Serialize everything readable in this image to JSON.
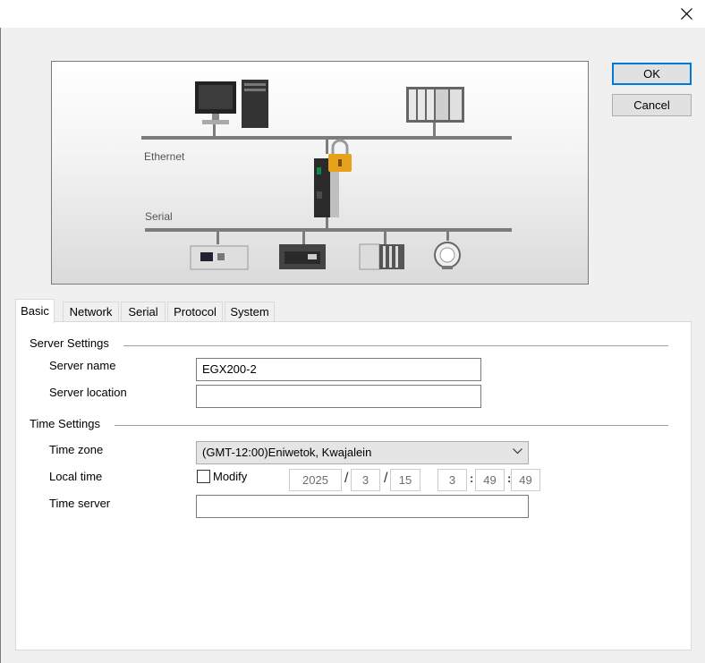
{
  "dialog": {
    "close_icon": "close-icon"
  },
  "diagram": {
    "ethernet_label": "Ethernet",
    "serial_label": "Serial"
  },
  "buttons": {
    "ok": "OK",
    "cancel": "Cancel"
  },
  "tabs": [
    {
      "label": "Basic",
      "active": true
    },
    {
      "label": "Network"
    },
    {
      "label": "Serial"
    },
    {
      "label": "Protocol"
    },
    {
      "label": "System"
    }
  ],
  "server_settings": {
    "group_label": "Server Settings",
    "name_label": "Server name",
    "name_value": "EGX200-2",
    "location_label": "Server location",
    "location_value": ""
  },
  "time_settings": {
    "group_label": "Time Settings",
    "zone_label": "Time zone",
    "zone_value": "(GMT-12:00)Eniwetok, Kwajalein",
    "local_time_label": "Local time",
    "modify_label": "Modify",
    "modify_checked": false,
    "date_sep": "/",
    "time_sep": ":",
    "year": "2025",
    "month": "3",
    "day": "15",
    "hour": "3",
    "minute": "49",
    "second": "49",
    "time_server_label": "Time server",
    "time_server_value": ""
  }
}
